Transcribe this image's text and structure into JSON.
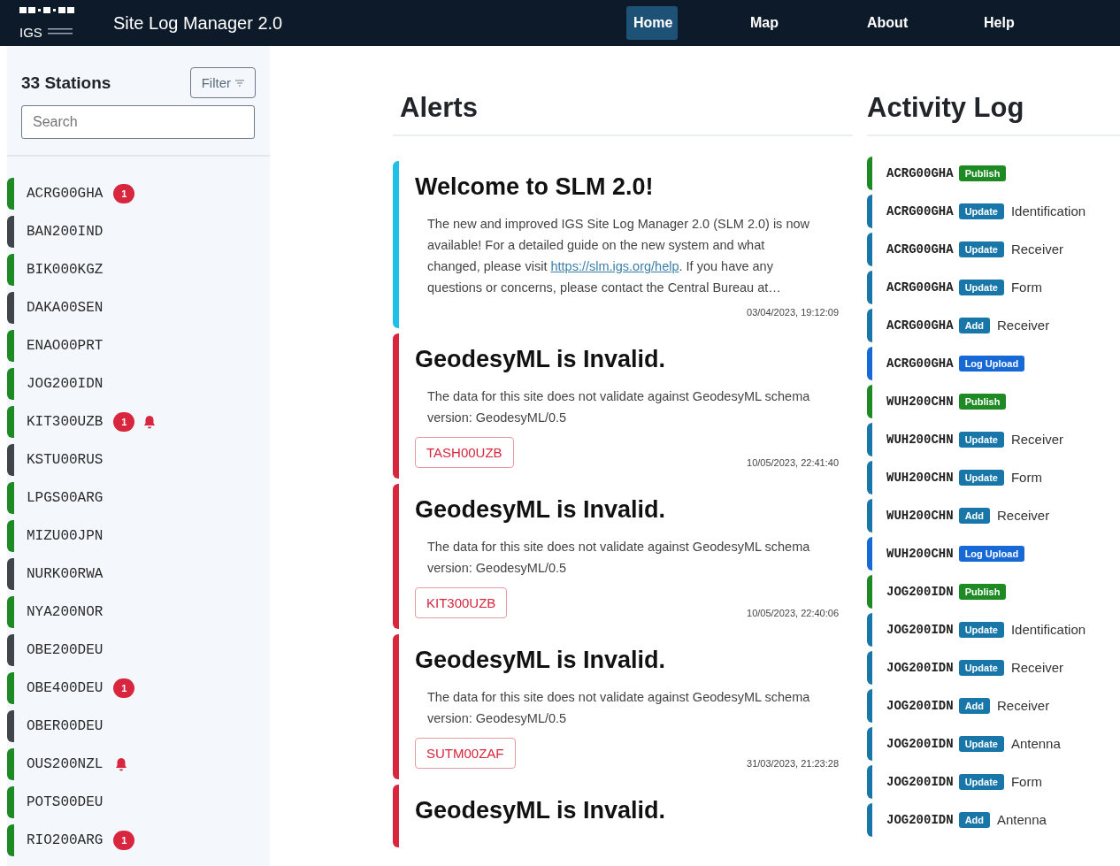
{
  "header": {
    "logo_text": "IGS",
    "title": "Site Log Manager 2.0",
    "nav": [
      {
        "label": "Home",
        "selected": true
      },
      {
        "label": "Map",
        "selected": false
      },
      {
        "label": "About",
        "selected": false
      },
      {
        "label": "Help",
        "selected": false
      }
    ]
  },
  "sidebar": {
    "count_title": "33 Stations",
    "filter_button": "Filter",
    "search": {
      "placeholder": "Search"
    },
    "stations": [
      {
        "name": "ACRG00GHA",
        "color": "#1e8a23",
        "badge": "1",
        "bell": false
      },
      {
        "name": "BAN200IND",
        "color": "#3f454b",
        "bell": false
      },
      {
        "name": "BIK000KGZ",
        "color": "#1e8a23",
        "bell": false
      },
      {
        "name": "DAKA00SEN",
        "color": "#3f454b",
        "bell": false
      },
      {
        "name": "ENAO00PRT",
        "color": "#1e8a23",
        "bell": false
      },
      {
        "name": "JOG200IDN",
        "color": "#1e8a23",
        "bell": false
      },
      {
        "name": "KIT300UZB",
        "color": "#1e8a23",
        "badge": "1",
        "bell": true
      },
      {
        "name": "KSTU00RUS",
        "color": "#3f454b",
        "bell": false
      },
      {
        "name": "LPGS00ARG",
        "color": "#1e8a23",
        "bell": false
      },
      {
        "name": "MIZU00JPN",
        "color": "#1e8a23",
        "bell": false
      },
      {
        "name": "NURK00RWA",
        "color": "#3f454b",
        "bell": false
      },
      {
        "name": "NYA200NOR",
        "color": "#1e8a23",
        "bell": false
      },
      {
        "name": "OBE200DEU",
        "color": "#3f454b",
        "bell": false
      },
      {
        "name": "OBE400DEU",
        "color": "#1e8a23",
        "badge": "1",
        "bell": false
      },
      {
        "name": "OBER00DEU",
        "color": "#3f454b",
        "bell": false
      },
      {
        "name": "OUS200NZL",
        "color": "#1e8a23",
        "bell": true
      },
      {
        "name": "POTS00DEU",
        "color": "#1e8a23",
        "bell": false
      },
      {
        "name": "RIO200ARG",
        "color": "#1e8a23",
        "badge": "1",
        "bell": false
      }
    ]
  },
  "alerts": {
    "title": "Alerts",
    "items": [
      {
        "kind": "info",
        "title": "Welcome to SLM 2.0!",
        "body_before": "The new and improved IGS Site Log Manager 2.0 (SLM 2.0) is now available! For a detailed guide on the new system and what changed, please visit ",
        "link": "https://slm.igs.org/help",
        "body_after": ". If you have any questions or concerns, please contact the Central Bureau at…",
        "time": "03/04/2023, 19:12:09"
      },
      {
        "kind": "error",
        "title": "GeodesyML is Invalid.",
        "body_before": "The data for this site does not validate against GeodesyML schema version: GeodesyML/0.5",
        "station": "TASH00UZB",
        "time": "10/05/2023, 22:41:40"
      },
      {
        "kind": "error",
        "title": "GeodesyML is Invalid.",
        "body_before": "The data for this site does not validate against GeodesyML schema version: GeodesyML/0.5",
        "station": "KIT300UZB",
        "time": "10/05/2023, 22:40:06"
      },
      {
        "kind": "error",
        "title": "GeodesyML is Invalid.",
        "body_before": "The data for this site does not validate against GeodesyML schema version: GeodesyML/0.5",
        "station": "SUTM00ZAF",
        "time": "31/03/2023, 21:23:28"
      },
      {
        "kind": "error",
        "title": "GeodesyML is Invalid."
      }
    ]
  },
  "activity": {
    "title": "Activity Log",
    "items": [
      {
        "station": "ACRG00GHA",
        "kind": "publish",
        "tag": "Publish"
      },
      {
        "station": "ACRG00GHA",
        "kind": "update",
        "tag": "Update",
        "section": "Identification"
      },
      {
        "station": "ACRG00GHA",
        "kind": "update",
        "tag": "Update",
        "section": "Receiver"
      },
      {
        "station": "ACRG00GHA",
        "kind": "update",
        "tag": "Update",
        "section": "Form"
      },
      {
        "station": "ACRG00GHA",
        "kind": "add",
        "tag": "Add",
        "section": "Receiver"
      },
      {
        "station": "ACRG00GHA",
        "kind": "upload",
        "tag": "Log Upload"
      },
      {
        "station": "WUH200CHN",
        "kind": "publish",
        "tag": "Publish"
      },
      {
        "station": "WUH200CHN",
        "kind": "update",
        "tag": "Update",
        "section": "Receiver"
      },
      {
        "station": "WUH200CHN",
        "kind": "update",
        "tag": "Update",
        "section": "Form"
      },
      {
        "station": "WUH200CHN",
        "kind": "add",
        "tag": "Add",
        "section": "Receiver"
      },
      {
        "station": "WUH200CHN",
        "kind": "upload",
        "tag": "Log Upload"
      },
      {
        "station": "JOG200IDN",
        "kind": "publish",
        "tag": "Publish"
      },
      {
        "station": "JOG200IDN",
        "kind": "update",
        "tag": "Update",
        "section": "Identification"
      },
      {
        "station": "JOG200IDN",
        "kind": "update",
        "tag": "Update",
        "section": "Receiver"
      },
      {
        "station": "JOG200IDN",
        "kind": "add",
        "tag": "Add",
        "section": "Receiver"
      },
      {
        "station": "JOG200IDN",
        "kind": "update",
        "tag": "Update",
        "section": "Antenna"
      },
      {
        "station": "JOG200IDN",
        "kind": "update",
        "tag": "Update",
        "section": "Form"
      },
      {
        "station": "JOG200IDN",
        "kind": "add",
        "tag": "Add",
        "section": "Antenna"
      }
    ]
  }
}
